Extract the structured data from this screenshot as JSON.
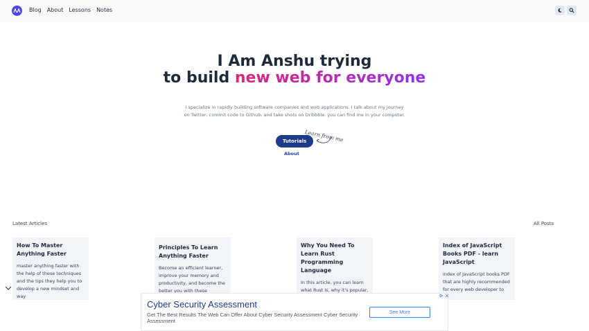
{
  "nav": {
    "items": [
      "Blog",
      "About",
      "Lessons",
      "Notes"
    ]
  },
  "hero": {
    "title_line1": "I Am Anshu trying",
    "title_line2_prefix": "to build",
    "title_line2_highlight": "new web for everyone",
    "description": "I specialize in rapidly building software companies and web applications. I talk about my journey on Twitter, commit code to Github, and take shots on Dribbble. you can find me in your computer.",
    "cta_label": "Tutorials",
    "learn_note": "Learn from me",
    "about_link": "About"
  },
  "articles": {
    "section_title": "Latest Articles",
    "all_posts_label": "All Posts",
    "items": [
      {
        "title": "How To Master Anything Faster",
        "excerpt": "master anything faster with the help of these techniques and the tips they help you to develop a new mindset and way"
      },
      {
        "title": "Principles To Learn Anything Faster",
        "excerpt": "Become an efficient learner, improve your memory and productivity, and become the better you with these"
      },
      {
        "title": "Why You Need To Learn Rust Programming Language",
        "excerpt": "In this article, you can learn what Rust is, why it's popular, what its benefits are, and what"
      },
      {
        "title": "Index of JavaScript Books PDF - learn JavaScript",
        "excerpt": "index of JavaScript books PDF that are highly recommended for every web developer to"
      }
    ]
  },
  "ad": {
    "headline": "Cyber Security Assessment",
    "body": "Get The Best Results The Web Can Offer About Cyber Security Assessment Cyber Security Assessment",
    "button_label": "See More"
  },
  "colors": {
    "brand": "#4f46e5",
    "cta": "#1e3a8a",
    "gradient_start": "#db2777",
    "gradient_end": "#9333ea"
  }
}
